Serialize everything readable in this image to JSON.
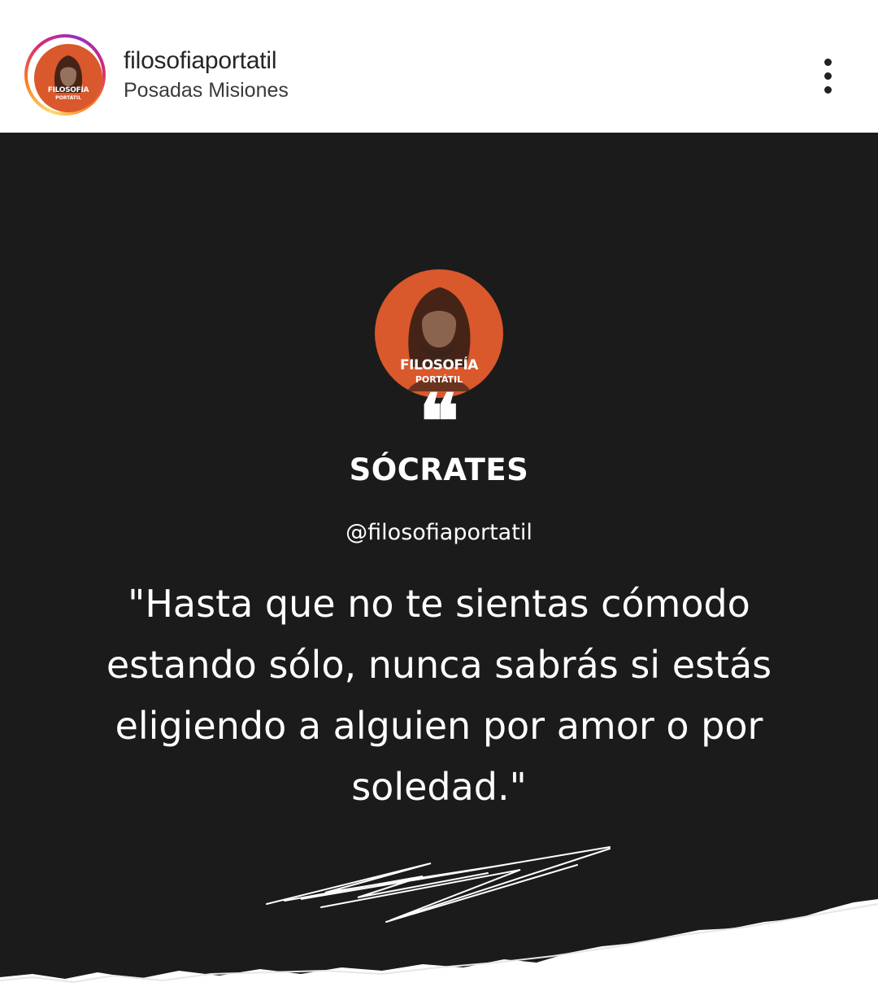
{
  "header": {
    "username": "filosofiaportatil",
    "location": "Posadas Misiones",
    "avatar_logo_line1": "FILOSOFÍA",
    "avatar_logo_line2": "PORTÁTIL",
    "more_icon": "more-vertical-icon"
  },
  "post": {
    "background_color": "#1b1b1b",
    "logo": {
      "line1": "FILOSOFÍA",
      "line2": "PORTÁTIL",
      "color": "#d9582c"
    },
    "quote_mark": "❝",
    "author": "SÓCRATES",
    "handle": "@filosofiaportatil",
    "quote_lines": [
      "\"Hasta que no te sientas cómodo",
      "estando sólo, nunca sabrás si estás",
      "eligiendo a alguien por amor o por",
      "soledad.\""
    ]
  }
}
